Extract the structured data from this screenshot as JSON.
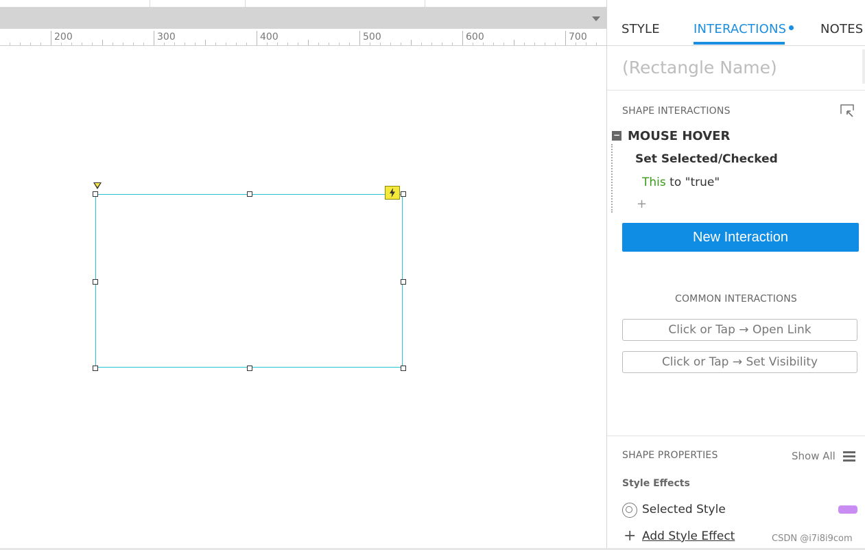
{
  "ruler": {
    "labels": [
      "200",
      "300",
      "400",
      "500",
      "600",
      "700"
    ]
  },
  "panel": {
    "tabs": {
      "style": "STYLE",
      "interactions": "INTERACTIONS",
      "notes": "NOTES"
    },
    "shape_name_placeholder": "(Rectangle Name)",
    "shape_interactions_label": "SHAPE INTERACTIONS",
    "event": {
      "collapse": "−",
      "title": "MOUSE HOVER",
      "action_title": "Set Selected/Checked",
      "target": "This",
      "detail": " to \"true\"",
      "add": "+"
    },
    "new_interaction": "New Interaction",
    "common_label": "COMMON INTERACTIONS",
    "common": [
      "Click or Tap → Open Link",
      "Click or Tap → Set Visibility"
    ],
    "shape_properties_label": "SHAPE PROPERTIES",
    "show_all": "Show All",
    "style_effects": "Style Effects",
    "selected_style": "Selected Style",
    "add_style_effect": "Add Style Effect",
    "add_style_effect_plus": "+"
  },
  "colors": {
    "accent": "#1a8ee0",
    "shape_border": "#27c4d8",
    "selected_swatch": "#c98cf2",
    "lightning_badge": "#f4e93a"
  },
  "watermark": "CSDN @i7i8i9com"
}
